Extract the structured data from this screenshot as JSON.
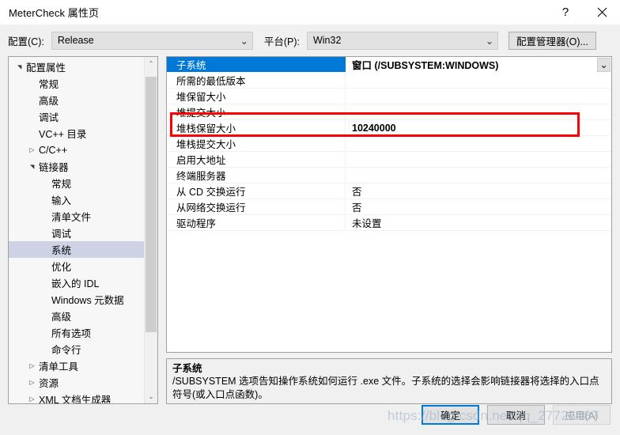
{
  "window": {
    "title": "MeterCheck 属性页",
    "help_label": "?",
    "close_label": "✕"
  },
  "config_bar": {
    "config_label": "配置(C):",
    "config_value": "Release",
    "platform_label": "平台(P):",
    "platform_value": "Win32",
    "config_manager_button": "配置管理器(O)...",
    "chevron": "⌄"
  },
  "tree": {
    "scroll_up": "⌃",
    "scroll_down": "⌄",
    "items": [
      {
        "label": "配置属性",
        "indent": 0,
        "arrow": "▲",
        "selected": false
      },
      {
        "label": "常规",
        "indent": 1,
        "arrow": "",
        "selected": false
      },
      {
        "label": "高级",
        "indent": 1,
        "arrow": "",
        "selected": false
      },
      {
        "label": "调试",
        "indent": 1,
        "arrow": "",
        "selected": false
      },
      {
        "label": "VC++ 目录",
        "indent": 1,
        "arrow": "",
        "selected": false
      },
      {
        "label": "C/C++",
        "indent": 1,
        "arrow": "▶",
        "selected": false
      },
      {
        "label": "链接器",
        "indent": 1,
        "arrow": "▲",
        "selected": false
      },
      {
        "label": "常规",
        "indent": 2,
        "arrow": "",
        "selected": false
      },
      {
        "label": "输入",
        "indent": 2,
        "arrow": "",
        "selected": false
      },
      {
        "label": "清单文件",
        "indent": 2,
        "arrow": "",
        "selected": false
      },
      {
        "label": "调试",
        "indent": 2,
        "arrow": "",
        "selected": false
      },
      {
        "label": "系统",
        "indent": 2,
        "arrow": "",
        "selected": true
      },
      {
        "label": "优化",
        "indent": 2,
        "arrow": "",
        "selected": false
      },
      {
        "label": "嵌入的 IDL",
        "indent": 2,
        "arrow": "",
        "selected": false
      },
      {
        "label": "Windows 元数据",
        "indent": 2,
        "arrow": "",
        "selected": false
      },
      {
        "label": "高级",
        "indent": 2,
        "arrow": "",
        "selected": false
      },
      {
        "label": "所有选项",
        "indent": 2,
        "arrow": "",
        "selected": false
      },
      {
        "label": "命令行",
        "indent": 2,
        "arrow": "",
        "selected": false
      },
      {
        "label": "清单工具",
        "indent": 1,
        "arrow": "▶",
        "selected": false
      },
      {
        "label": "资源",
        "indent": 1,
        "arrow": "▶",
        "selected": false
      },
      {
        "label": "XML 文档生成器",
        "indent": 1,
        "arrow": "▶",
        "selected": false
      }
    ]
  },
  "property_grid": {
    "dropdown_chevron": "⌄",
    "rows": [
      {
        "name": "子系统",
        "value": "窗口 (/SUBSYSTEM:WINDOWS)",
        "selected": true,
        "bold": true,
        "dropdown": true
      },
      {
        "name": "所需的最低版本",
        "value": "",
        "selected": false,
        "bold": false,
        "dropdown": false
      },
      {
        "name": "堆保留大小",
        "value": "",
        "selected": false,
        "bold": false,
        "dropdown": false
      },
      {
        "name": "堆提交大小",
        "value": "",
        "selected": false,
        "bold": false,
        "dropdown": false
      },
      {
        "name": "堆栈保留大小",
        "value": "10240000",
        "selected": false,
        "bold": true,
        "dropdown": false
      },
      {
        "name": "堆栈提交大小",
        "value": "",
        "selected": false,
        "bold": false,
        "dropdown": false
      },
      {
        "name": "启用大地址",
        "value": "",
        "selected": false,
        "bold": false,
        "dropdown": false
      },
      {
        "name": "终端服务器",
        "value": "",
        "selected": false,
        "bold": false,
        "dropdown": false
      },
      {
        "name": "从 CD 交换运行",
        "value": "否",
        "selected": false,
        "bold": false,
        "dropdown": false
      },
      {
        "name": "从网络交换运行",
        "value": "否",
        "selected": false,
        "bold": false,
        "dropdown": false
      },
      {
        "name": "驱动程序",
        "value": "未设置",
        "selected": false,
        "bold": false,
        "dropdown": false
      }
    ]
  },
  "description": {
    "title": "子系统",
    "body": "/SUBSYSTEM 选项告知操作系统如何运行 .exe 文件。子系统的选择会影响链接器将选择的入口点符号(或入口点函数)。"
  },
  "footer": {
    "ok_label": "确定",
    "cancel_label": "取消",
    "apply_label": "应用(A)"
  },
  "watermark": {
    "text": "https://blog.csdn.net/qq_27726087"
  },
  "colors": {
    "accent": "#0078d7",
    "highlight_rect": "#ff0000",
    "tree_selection": "#cdd3e5",
    "dialog_bg": "#f0f0f0"
  }
}
